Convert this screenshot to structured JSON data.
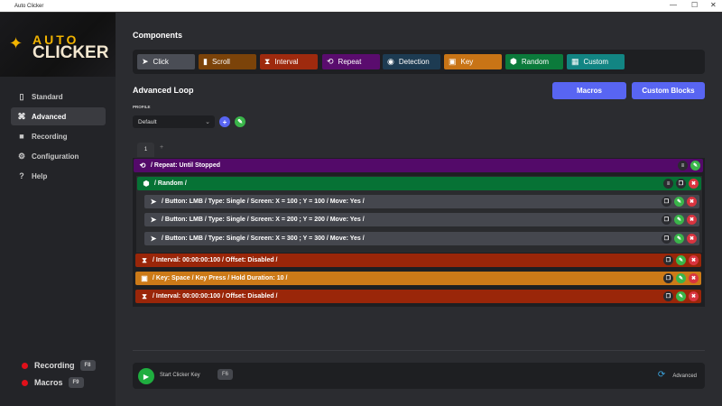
{
  "window": {
    "title": "Auto Clicker",
    "minimize": "—",
    "maximize": "☐",
    "close": "✕"
  },
  "logo": {
    "line1": "AUTO",
    "line2": "CLICKER"
  },
  "sidebar": {
    "items": [
      {
        "label": "Standard",
        "icon": "mouse-icon",
        "glyph": "▯"
      },
      {
        "label": "Advanced",
        "icon": "grid-icon",
        "glyph": "⌘"
      },
      {
        "label": "Recording",
        "icon": "camera-icon",
        "glyph": "■"
      },
      {
        "label": "Configuration",
        "icon": "gear-icon",
        "glyph": "⚙"
      },
      {
        "label": "Help",
        "icon": "question-icon",
        "glyph": "?"
      }
    ],
    "active": "Advanced",
    "status": [
      {
        "label": "Recording",
        "key": "F8"
      },
      {
        "label": "Macros",
        "key": "F9"
      }
    ]
  },
  "components": {
    "title": "Components",
    "buttons": [
      {
        "label": "Click",
        "glyph": "➤",
        "color": "#4a4d55"
      },
      {
        "label": "Scroll",
        "glyph": "▮",
        "color": "#7b4309"
      },
      {
        "label": "Interval",
        "glyph": "⧗",
        "color": "#9e2a0e"
      },
      {
        "label": "Repeat",
        "glyph": "⟲",
        "color": "#5a0c6e"
      },
      {
        "label": "Detection",
        "glyph": "◉",
        "color": "#1d3b52"
      },
      {
        "label": "Key",
        "glyph": "▣",
        "color": "#c87416"
      },
      {
        "label": "Random",
        "glyph": "⬢",
        "color": "#0b7a3b"
      },
      {
        "label": "Custom",
        "glyph": "▦",
        "color": "#128583"
      }
    ]
  },
  "advanced_loop": {
    "title": "Advanced Loop",
    "macros": "Macros",
    "custom_blocks": "Custom Blocks",
    "profile_label": "PROFILE",
    "profile_value": "Default",
    "tabs": [
      "1"
    ],
    "add_tab": "+",
    "rows": {
      "repeat": "/  Repeat: Until Stopped",
      "random": "/  Random  /",
      "clicks": [
        "/  Button: LMB  /  Type: Single  /  Screen: X = 100 ; Y = 100  /  Move: Yes  /",
        "/  Button: LMB  /  Type: Single  /  Screen: X = 200 ; Y = 200  /  Move: Yes  /",
        "/  Button: LMB  /  Type: Single  /  Screen: X = 300 ; Y = 300  /  Move: Yes  /"
      ],
      "interval1": "/  Interval: 00:00:00:100  /  Offset: Disabled  /",
      "key": "/  Key: Space  /  Key Press  /  Hold Duration: 10  /",
      "interval2": "/  Interval: 00:00:00:100  /  Offset: Disabled  /"
    }
  },
  "footer": {
    "start_label": "Start Clicker Key",
    "start_key": "F6",
    "mode": "Advanced"
  },
  "colors": {
    "repeat": "#530a69",
    "random": "#067235",
    "click": "#45474e",
    "interval": "#9a2609",
    "key": "#cc7a18",
    "accent": "#5865f2"
  }
}
